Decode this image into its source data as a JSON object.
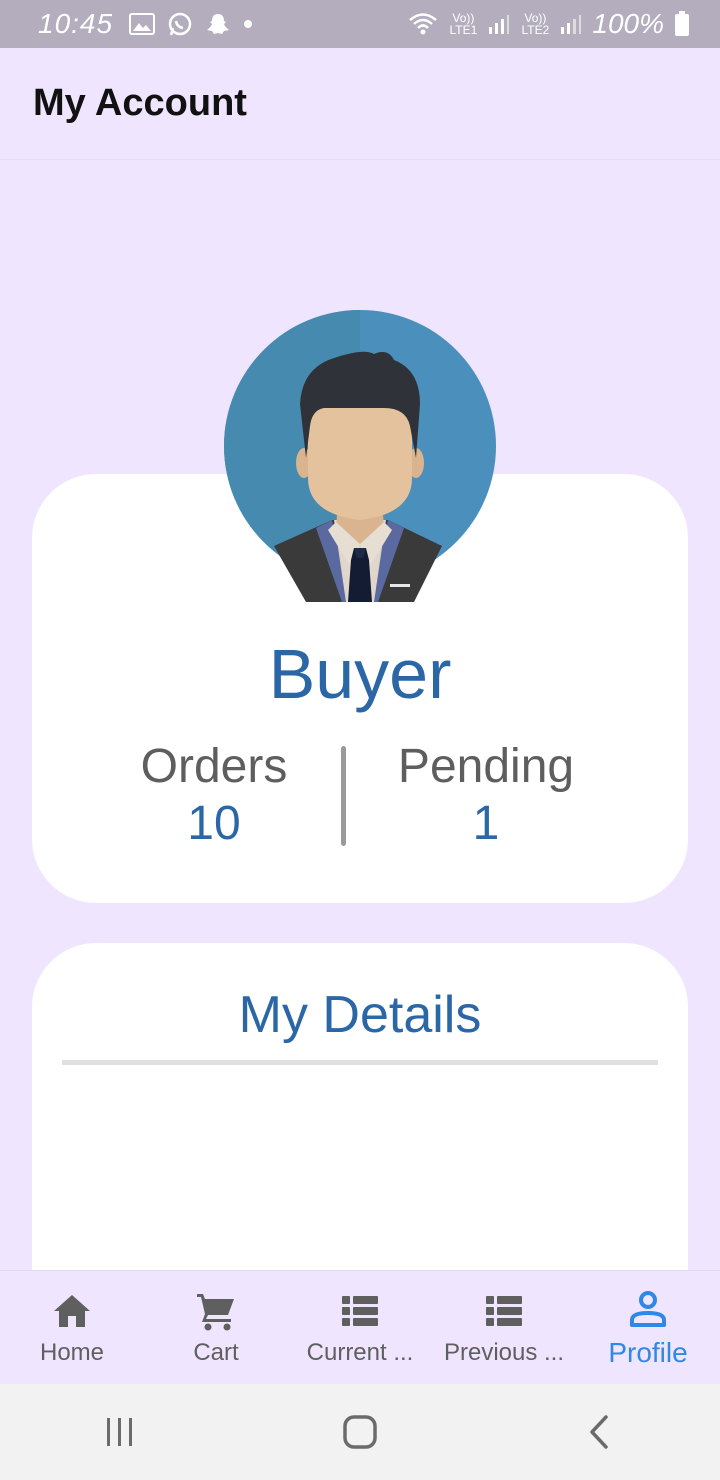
{
  "status_bar": {
    "time": "10:45",
    "sim1": "Vo)) LTE1",
    "sim2": "Vo)) LTE2",
    "battery": "100%"
  },
  "app_bar": {
    "title": "My Account"
  },
  "profile": {
    "role": "Buyer",
    "stats": [
      {
        "label": "Orders",
        "value": "10"
      },
      {
        "label": "Pending",
        "value": "1"
      }
    ]
  },
  "details": {
    "title": "My Details"
  },
  "bottom_nav": {
    "items": [
      {
        "label": "Home",
        "icon": "home-icon"
      },
      {
        "label": "Cart",
        "icon": "cart-icon"
      },
      {
        "label": "Current ...",
        "icon": "list-icon"
      },
      {
        "label": "Previous ...",
        "icon": "list-icon"
      },
      {
        "label": "Profile",
        "icon": "person-icon",
        "active": true
      }
    ]
  },
  "colors": {
    "background": "#efe5ff",
    "accent": "#2b67a6",
    "nav_active": "#2f88e6"
  }
}
